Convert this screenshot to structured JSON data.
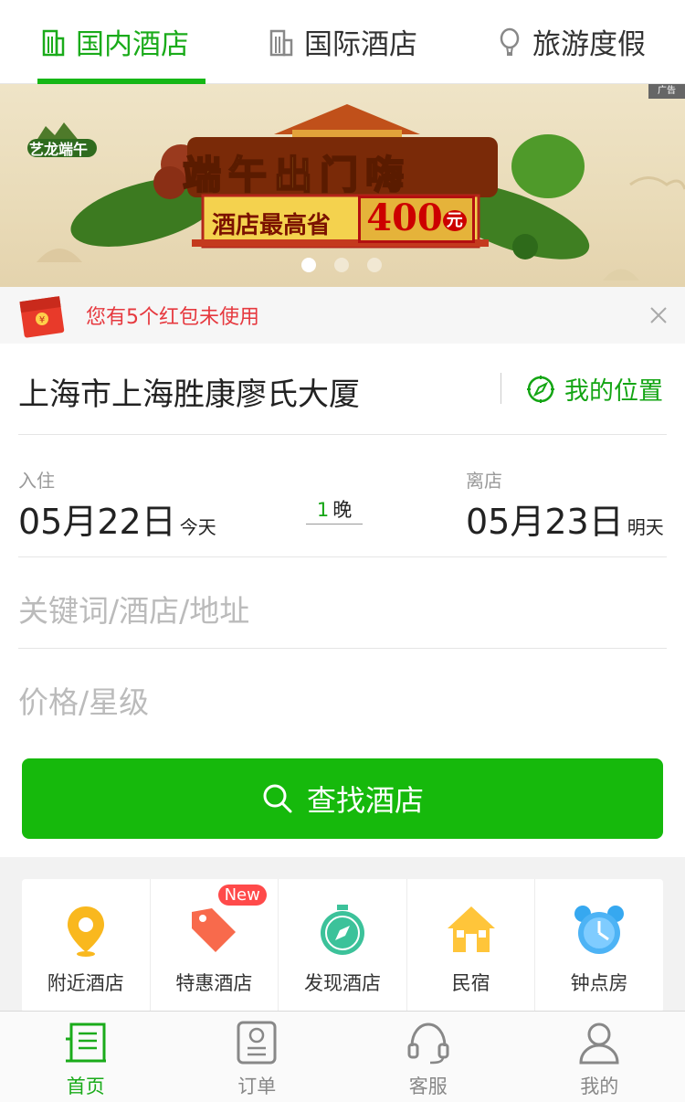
{
  "top_tabs": [
    {
      "label": "国内酒店",
      "icon": "building-icon"
    },
    {
      "label": "国际酒店",
      "icon": "city-icon"
    },
    {
      "label": "旅游度假",
      "icon": "balloon-icon"
    }
  ],
  "banner": {
    "badge": "艺龙端午",
    "title": "端午出门嗨",
    "subtitle": "酒店最高省",
    "amount": "400",
    "amount_unit": "元",
    "ad_tag": "广告"
  },
  "red_packet": {
    "text": "您有5个红包未使用"
  },
  "search": {
    "location": "上海市上海胜康廖氏大厦",
    "my_location": "我的位置",
    "checkin_label": "入住",
    "checkin_date": "05月22日",
    "checkin_day": "今天",
    "nights_count": "1",
    "nights_unit": "晚",
    "checkout_label": "离店",
    "checkout_date": "05月23日",
    "checkout_day": "明天",
    "keyword_placeholder": "关键词/酒店/地址",
    "price_placeholder": "价格/星级",
    "search_button": "查找酒店"
  },
  "quick_links": [
    {
      "label": "附近酒店",
      "icon": "location-pin-icon"
    },
    {
      "label": "特惠酒店",
      "icon": "price-tag-icon",
      "badge": "New"
    },
    {
      "label": "发现酒店",
      "icon": "compass-stopwatch-icon"
    },
    {
      "label": "民宿",
      "icon": "house-icon"
    },
    {
      "label": "钟点房",
      "icon": "alarm-clock-icon"
    }
  ],
  "bottom_nav": [
    {
      "label": "首页",
      "icon": "home-building-icon"
    },
    {
      "label": "订单",
      "icon": "order-icon"
    },
    {
      "label": "客服",
      "icon": "headset-icon"
    },
    {
      "label": "我的",
      "icon": "user-icon"
    }
  ],
  "colors": {
    "brand_green": "#16b90c",
    "accent_red": "#e6393f",
    "badge_red": "#ff4a4a"
  }
}
